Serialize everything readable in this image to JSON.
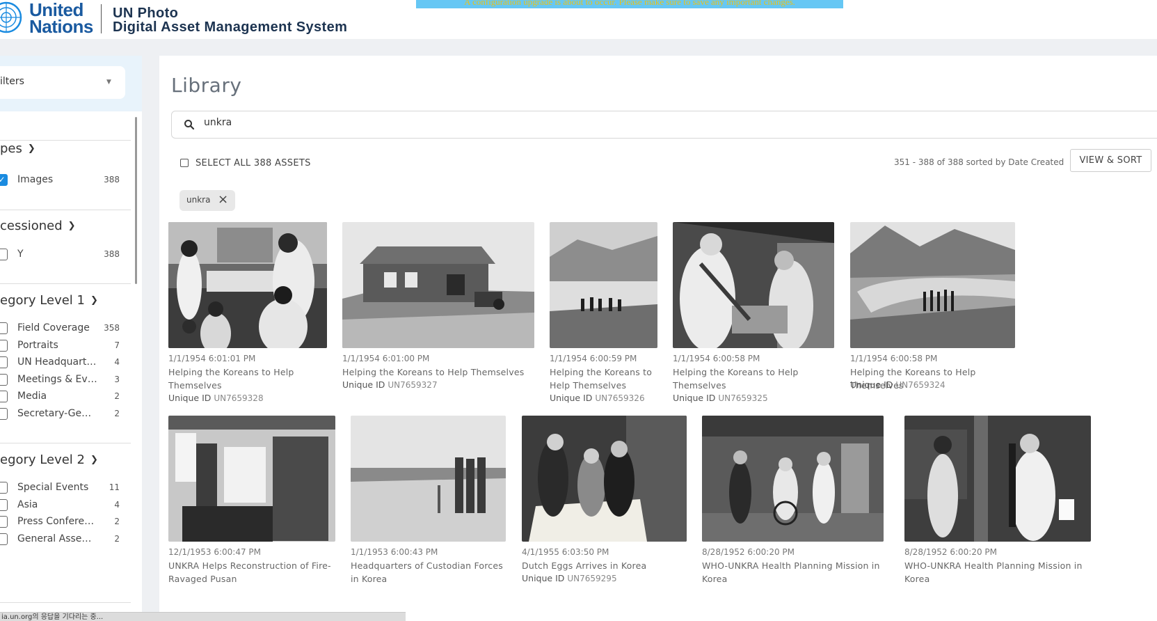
{
  "header": {
    "brand_line1": "United",
    "brand_line2": "Nations",
    "app_line1": "UN Photo",
    "app_line2": "Digital Asset Management System",
    "banner_text": "A configuration upgrade is about to occur. Please make sure to save any important changes."
  },
  "sidebar": {
    "filters_label": "ilters",
    "groups": [
      {
        "title": "pes",
        "items": [
          {
            "label": "Images",
            "count": "388",
            "checked": true
          }
        ]
      },
      {
        "title": "cessioned",
        "items": [
          {
            "label": "Y",
            "count": "388",
            "checked": false
          }
        ]
      },
      {
        "title": "egory Level 1",
        "items": [
          {
            "label": "Field Coverage",
            "count": "358",
            "checked": false
          },
          {
            "label": "Portraits",
            "count": "7",
            "checked": false
          },
          {
            "label": "UN Headquarters",
            "count": "4",
            "checked": false
          },
          {
            "label": "Meetings & Eve...",
            "count": "3",
            "checked": false
          },
          {
            "label": "Media",
            "count": "2",
            "checked": false
          },
          {
            "label": "Secretary-Gener...",
            "count": "2",
            "checked": false
          }
        ]
      },
      {
        "title": "egory Level 2",
        "items": [
          {
            "label": "Special Events",
            "count": "11",
            "checked": false
          },
          {
            "label": "Asia",
            "count": "4",
            "checked": false
          },
          {
            "label": "Press Conferenc...",
            "count": "2",
            "checked": false
          },
          {
            "label": "General Assembly",
            "count": "2",
            "checked": false
          }
        ]
      }
    ]
  },
  "main": {
    "title": "Library",
    "search_value": "unkra",
    "select_all_label": "SELECT ALL 388 ASSETS",
    "result_info": "351 - 388 of 388 sorted by Date Created",
    "view_sort_label": "VIEW & SORT",
    "chip_label": "unkra",
    "uid_prefix": "Unique ID",
    "assets": [
      {
        "date": "1/1/1954 6:01:01 PM",
        "title": "Helping the Koreans to Help Themselves",
        "uid": "UN7659328"
      },
      {
        "date": "1/1/1954 6:01:00 PM",
        "title": "Helping the Koreans to Help Themselves",
        "uid": "UN7659327"
      },
      {
        "date": "1/1/1954 6:00:59 PM",
        "title": "Helping the Koreans to Help Themselves",
        "uid": "UN7659326"
      },
      {
        "date": "1/1/1954 6:00:58 PM",
        "title": "Helping the Koreans to Help Themselves",
        "uid": "UN7659325"
      },
      {
        "date": "1/1/1954 6:00:58 PM",
        "title": "Helping the Koreans to Help Themselves",
        "uid": "UN7659324"
      },
      {
        "date": "12/1/1953 6:00:47 PM",
        "title": "UNKRA Helps Reconstruction of Fire-Ravaged Pusan",
        "uid": ""
      },
      {
        "date": "1/1/1953 6:00:43 PM",
        "title": "Headquarters of Custodian Forces in Korea",
        "uid": ""
      },
      {
        "date": "4/1/1955 6:03:50 PM",
        "title": "Dutch Eggs Arrives in Korea",
        "uid": "UN7659295"
      },
      {
        "date": "8/28/1952 6:00:20 PM",
        "title": "WHO-UNKRA Health Planning Mission in Korea",
        "uid": ""
      },
      {
        "date": "8/28/1952 6:00:20 PM",
        "title": "WHO-UNKRA Health Planning Mission in Korea",
        "uid": ""
      }
    ]
  },
  "statusbar": {
    "text": "ia.un.org의 응답을 기다리는 중..."
  },
  "colors": {
    "brand_blue": "#1a5aa0",
    "accent": "#1a8be0",
    "banner": "#66c7f4"
  }
}
